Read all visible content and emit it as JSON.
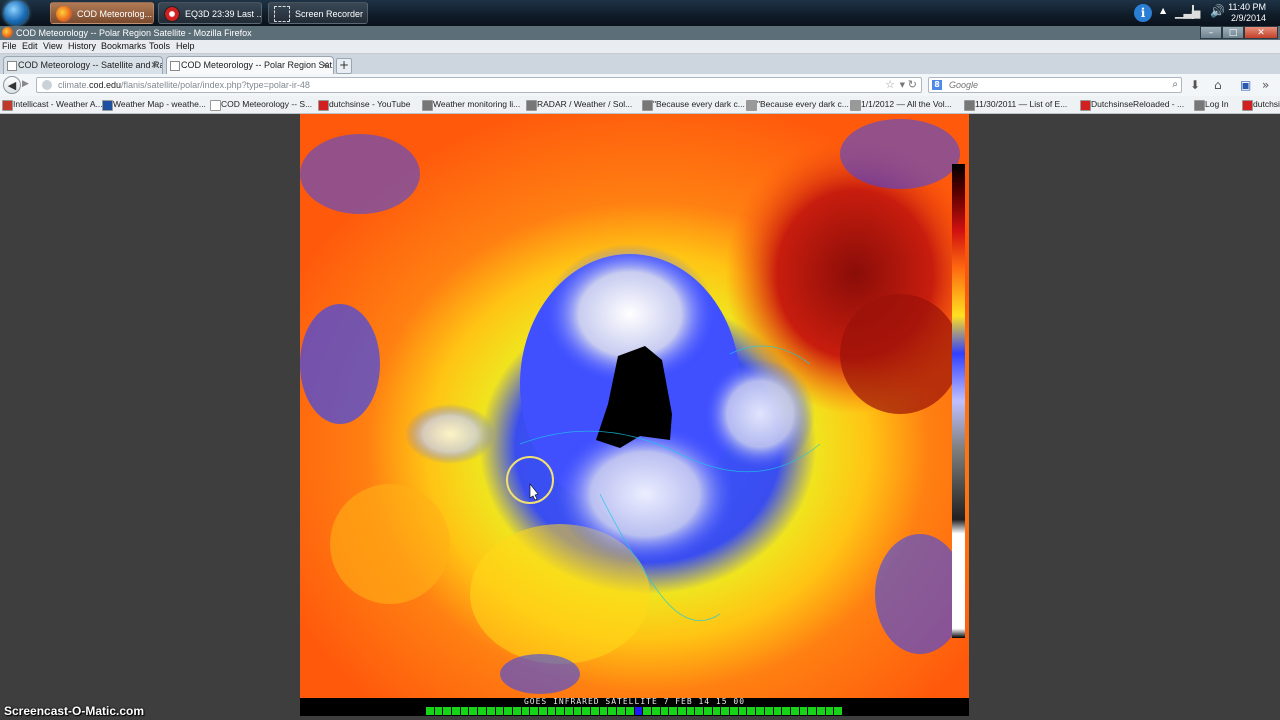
{
  "taskbar": {
    "buttons": [
      {
        "label": "COD Meteorolog...",
        "icon": "firefox-icon"
      },
      {
        "label": "EQ3D  23:39 Last ...",
        "icon": "eq3d-icon"
      },
      {
        "label": "Screen Recorder",
        "icon": "screen-recorder-icon"
      }
    ],
    "clock": {
      "time": "11:40 PM",
      "date": "2/9/2014"
    }
  },
  "window": {
    "title": "COD Meteorology -- Polar Region Satellite - Mozilla Firefox",
    "minimize": "–",
    "maximize": "□",
    "close": "✕"
  },
  "menu": [
    "File",
    "Edit",
    "View",
    "History",
    "Bookmarks",
    "Tools",
    "Help"
  ],
  "tabs": [
    {
      "label": "COD Meteorology -- Satellite and Ra...",
      "active": false
    },
    {
      "label": "COD Meteorology -- Polar Region Sat...",
      "active": true
    }
  ],
  "new_tab": "+",
  "nav": {
    "url_domain": "climate.cod.edu",
    "url_prefix": "climate.",
    "url_host": "cod.edu",
    "url_path": "/flanis/satellite/polar/index.php?type=polar-ir-48",
    "search_placeholder": "Google",
    "search_engine_letter": "8"
  },
  "bookmarks": [
    {
      "label": "Intellicast - Weather A...",
      "color": "#c0392b"
    },
    {
      "label": "Weather Map - weathe...",
      "color": "#1f4fa0"
    },
    {
      "label": "COD Meteorology -- S...",
      "color": "#ffffff"
    },
    {
      "label": "dutchsinse - YouTube",
      "color": "#d21f1f"
    },
    {
      "label": "Weather monitoring li...",
      "color": "#777777"
    },
    {
      "label": "RADAR / Weather / Sol...",
      "color": "#777777"
    },
    {
      "label": "\"Because every dark c...",
      "color": "#777777"
    },
    {
      "label": "\"Because every dark c...",
      "color": "#999999"
    },
    {
      "label": "1/1/2012 — All the Vol...",
      "color": "#999999"
    },
    {
      "label": "11/30/2011 — List of E...",
      "color": "#777777"
    },
    {
      "label": "DutchsinseReloaded - ...",
      "color": "#d21f1f"
    },
    {
      "label": "Log In",
      "color": "#777777"
    },
    {
      "label": "dutchsinse - YouTube",
      "color": "#d21f1f"
    }
  ],
  "satellite": {
    "caption": "GOES INFRARED SATELLITE  7 FEB 14  15 00",
    "frame_count": 48,
    "current_frame": 24
  },
  "watermark": "Screencast-O-Matic.com",
  "colors": {
    "warm": "#ff6a10",
    "yellow": "#f4e21a",
    "cold_blue": "#2a3fe0",
    "progress": "#18d418"
  }
}
